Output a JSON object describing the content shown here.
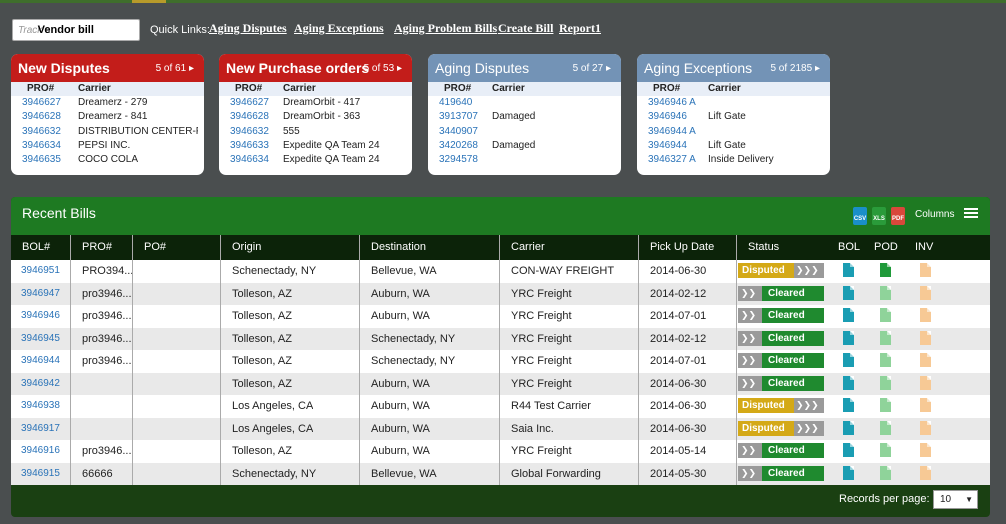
{
  "search": {
    "placeholder": "Track a",
    "value": "Vendor bill"
  },
  "quick_links": {
    "label": "Quick Links:",
    "links": [
      "Aging Disputes",
      "Aging Exceptions",
      "Aging Problem Bills",
      "Create Bill",
      "Report1"
    ]
  },
  "widgets": [
    {
      "title": "New Disputes",
      "pager": "5 of 61",
      "col1": "PRO#",
      "col2": "Carrier",
      "rows": [
        {
          "pro": "3946627",
          "carrier": "Dreamerz - 279"
        },
        {
          "pro": "3946628",
          "carrier": "Dreamerz - 841"
        },
        {
          "pro": "3946632",
          "carrier": "DISTRIBUTION CENTER-P..."
        },
        {
          "pro": "3946634",
          "carrier": "PEPSI INC."
        },
        {
          "pro": "3946635",
          "carrier": "COCO COLA"
        }
      ]
    },
    {
      "title": "New Purchase orders",
      "pager": "5 of 53",
      "col1": "PRO#",
      "col2": "Carrier",
      "rows": [
        {
          "pro": "3946627",
          "carrier": "DreamOrbit - 417"
        },
        {
          "pro": "3946628",
          "carrier": "DreamOrbit - 363"
        },
        {
          "pro": "3946632",
          "carrier": "555"
        },
        {
          "pro": "3946633",
          "carrier": "Expedite QA Team 24"
        },
        {
          "pro": "3946634",
          "carrier": "Expedite QA Team 24"
        }
      ]
    },
    {
      "title": "Aging Disputes",
      "pager": "5 of 27",
      "col1": "PRO#",
      "col2": "Carrier",
      "rows": [
        {
          "pro": "419640",
          "carrier": ""
        },
        {
          "pro": "3913707",
          "carrier": "Damaged"
        },
        {
          "pro": "3440907",
          "carrier": ""
        },
        {
          "pro": "3420268",
          "carrier": "Damaged"
        },
        {
          "pro": "3294578",
          "carrier": ""
        }
      ]
    },
    {
      "title": "Aging  Exceptions",
      "pager": "5 of 2185",
      "col1": "PRO#",
      "col2": "Carrier",
      "rows": [
        {
          "pro": "3946946 A",
          "carrier": ""
        },
        {
          "pro": "3946946",
          "carrier": "Lift Gate"
        },
        {
          "pro": "3946944 A",
          "carrier": ""
        },
        {
          "pro": "3946944",
          "carrier": "Lift Gate"
        },
        {
          "pro": "3946327 A",
          "carrier": "Inside Delivery"
        }
      ]
    }
  ],
  "recent_bills": {
    "title": "Recent Bills",
    "export": [
      "CSV",
      "XLS",
      "PDF"
    ],
    "columns_label": "Columns",
    "headers": [
      "BOL#",
      "PRO#",
      "PO#",
      "Origin",
      "Destination",
      "Carrier",
      "Pick Up Date",
      "Status",
      "BOL",
      "POD",
      "INV"
    ],
    "rows": [
      {
        "bol": "3946951",
        "pro": "PRO394...",
        "po": "",
        "origin": "Schenectady, NY",
        "dest": "Bellevue, WA",
        "carrier": "CON-WAY FREIGHT",
        "date": "2014-06-30",
        "status": "Disputed",
        "pod": "green"
      },
      {
        "bol": "3946947",
        "pro": "pro3946...",
        "po": "",
        "origin": "Tolleson, AZ",
        "dest": "Auburn, WA",
        "carrier": "YRC Freight",
        "date": "2014-02-12",
        "status": "Cleared",
        "pod": "light"
      },
      {
        "bol": "3946946",
        "pro": "pro3946...",
        "po": "",
        "origin": "Tolleson, AZ",
        "dest": "Auburn, WA",
        "carrier": "YRC Freight",
        "date": "2014-07-01",
        "status": "Cleared",
        "pod": "light"
      },
      {
        "bol": "3946945",
        "pro": "pro3946...",
        "po": "",
        "origin": "Tolleson, AZ",
        "dest": "Schenectady, NY",
        "carrier": "YRC Freight",
        "date": "2014-02-12",
        "status": "Cleared",
        "pod": "light"
      },
      {
        "bol": "3946944",
        "pro": "pro3946...",
        "po": "",
        "origin": "Tolleson, AZ",
        "dest": "Schenectady, NY",
        "carrier": "YRC Freight",
        "date": "2014-07-01",
        "status": "Cleared",
        "pod": "light"
      },
      {
        "bol": "3946942",
        "pro": "",
        "po": "",
        "origin": "Tolleson, AZ",
        "dest": "Auburn, WA",
        "carrier": "YRC Freight",
        "date": "2014-06-30",
        "status": "Cleared",
        "pod": "light"
      },
      {
        "bol": "3946938",
        "pro": "",
        "po": "",
        "origin": "Los Angeles, CA",
        "dest": "Auburn, WA",
        "carrier": "R44 Test Carrier",
        "date": "2014-06-30",
        "status": "Disputed",
        "pod": "light"
      },
      {
        "bol": "3946917",
        "pro": "",
        "po": "",
        "origin": "Los Angeles, CA",
        "dest": "Auburn, WA",
        "carrier": "Saia Inc.",
        "date": "2014-06-30",
        "status": "Disputed",
        "pod": "light"
      },
      {
        "bol": "3946916",
        "pro": "pro3946...",
        "po": "",
        "origin": "Tolleson, AZ",
        "dest": "Auburn, WA",
        "carrier": "YRC Freight",
        "date": "2014-05-14",
        "status": "Cleared",
        "pod": "light"
      },
      {
        "bol": "3946915",
        "pro": "66666",
        "po": "",
        "origin": "Schenectady, NY",
        "dest": "Bellevue, WA",
        "carrier": "Global Forwarding",
        "date": "2014-05-30",
        "status": "Cleared",
        "pod": "light"
      }
    ],
    "records_per_page_label": "Records per page:",
    "records_per_page": "10"
  },
  "colors": {
    "disputed": "#d4a917",
    "cleared": "#1f8a2f",
    "link": "#2a73b8",
    "widget_red": "#c31d1a",
    "widget_blue": "#7393b6",
    "bills_header": "#1e7a22"
  }
}
